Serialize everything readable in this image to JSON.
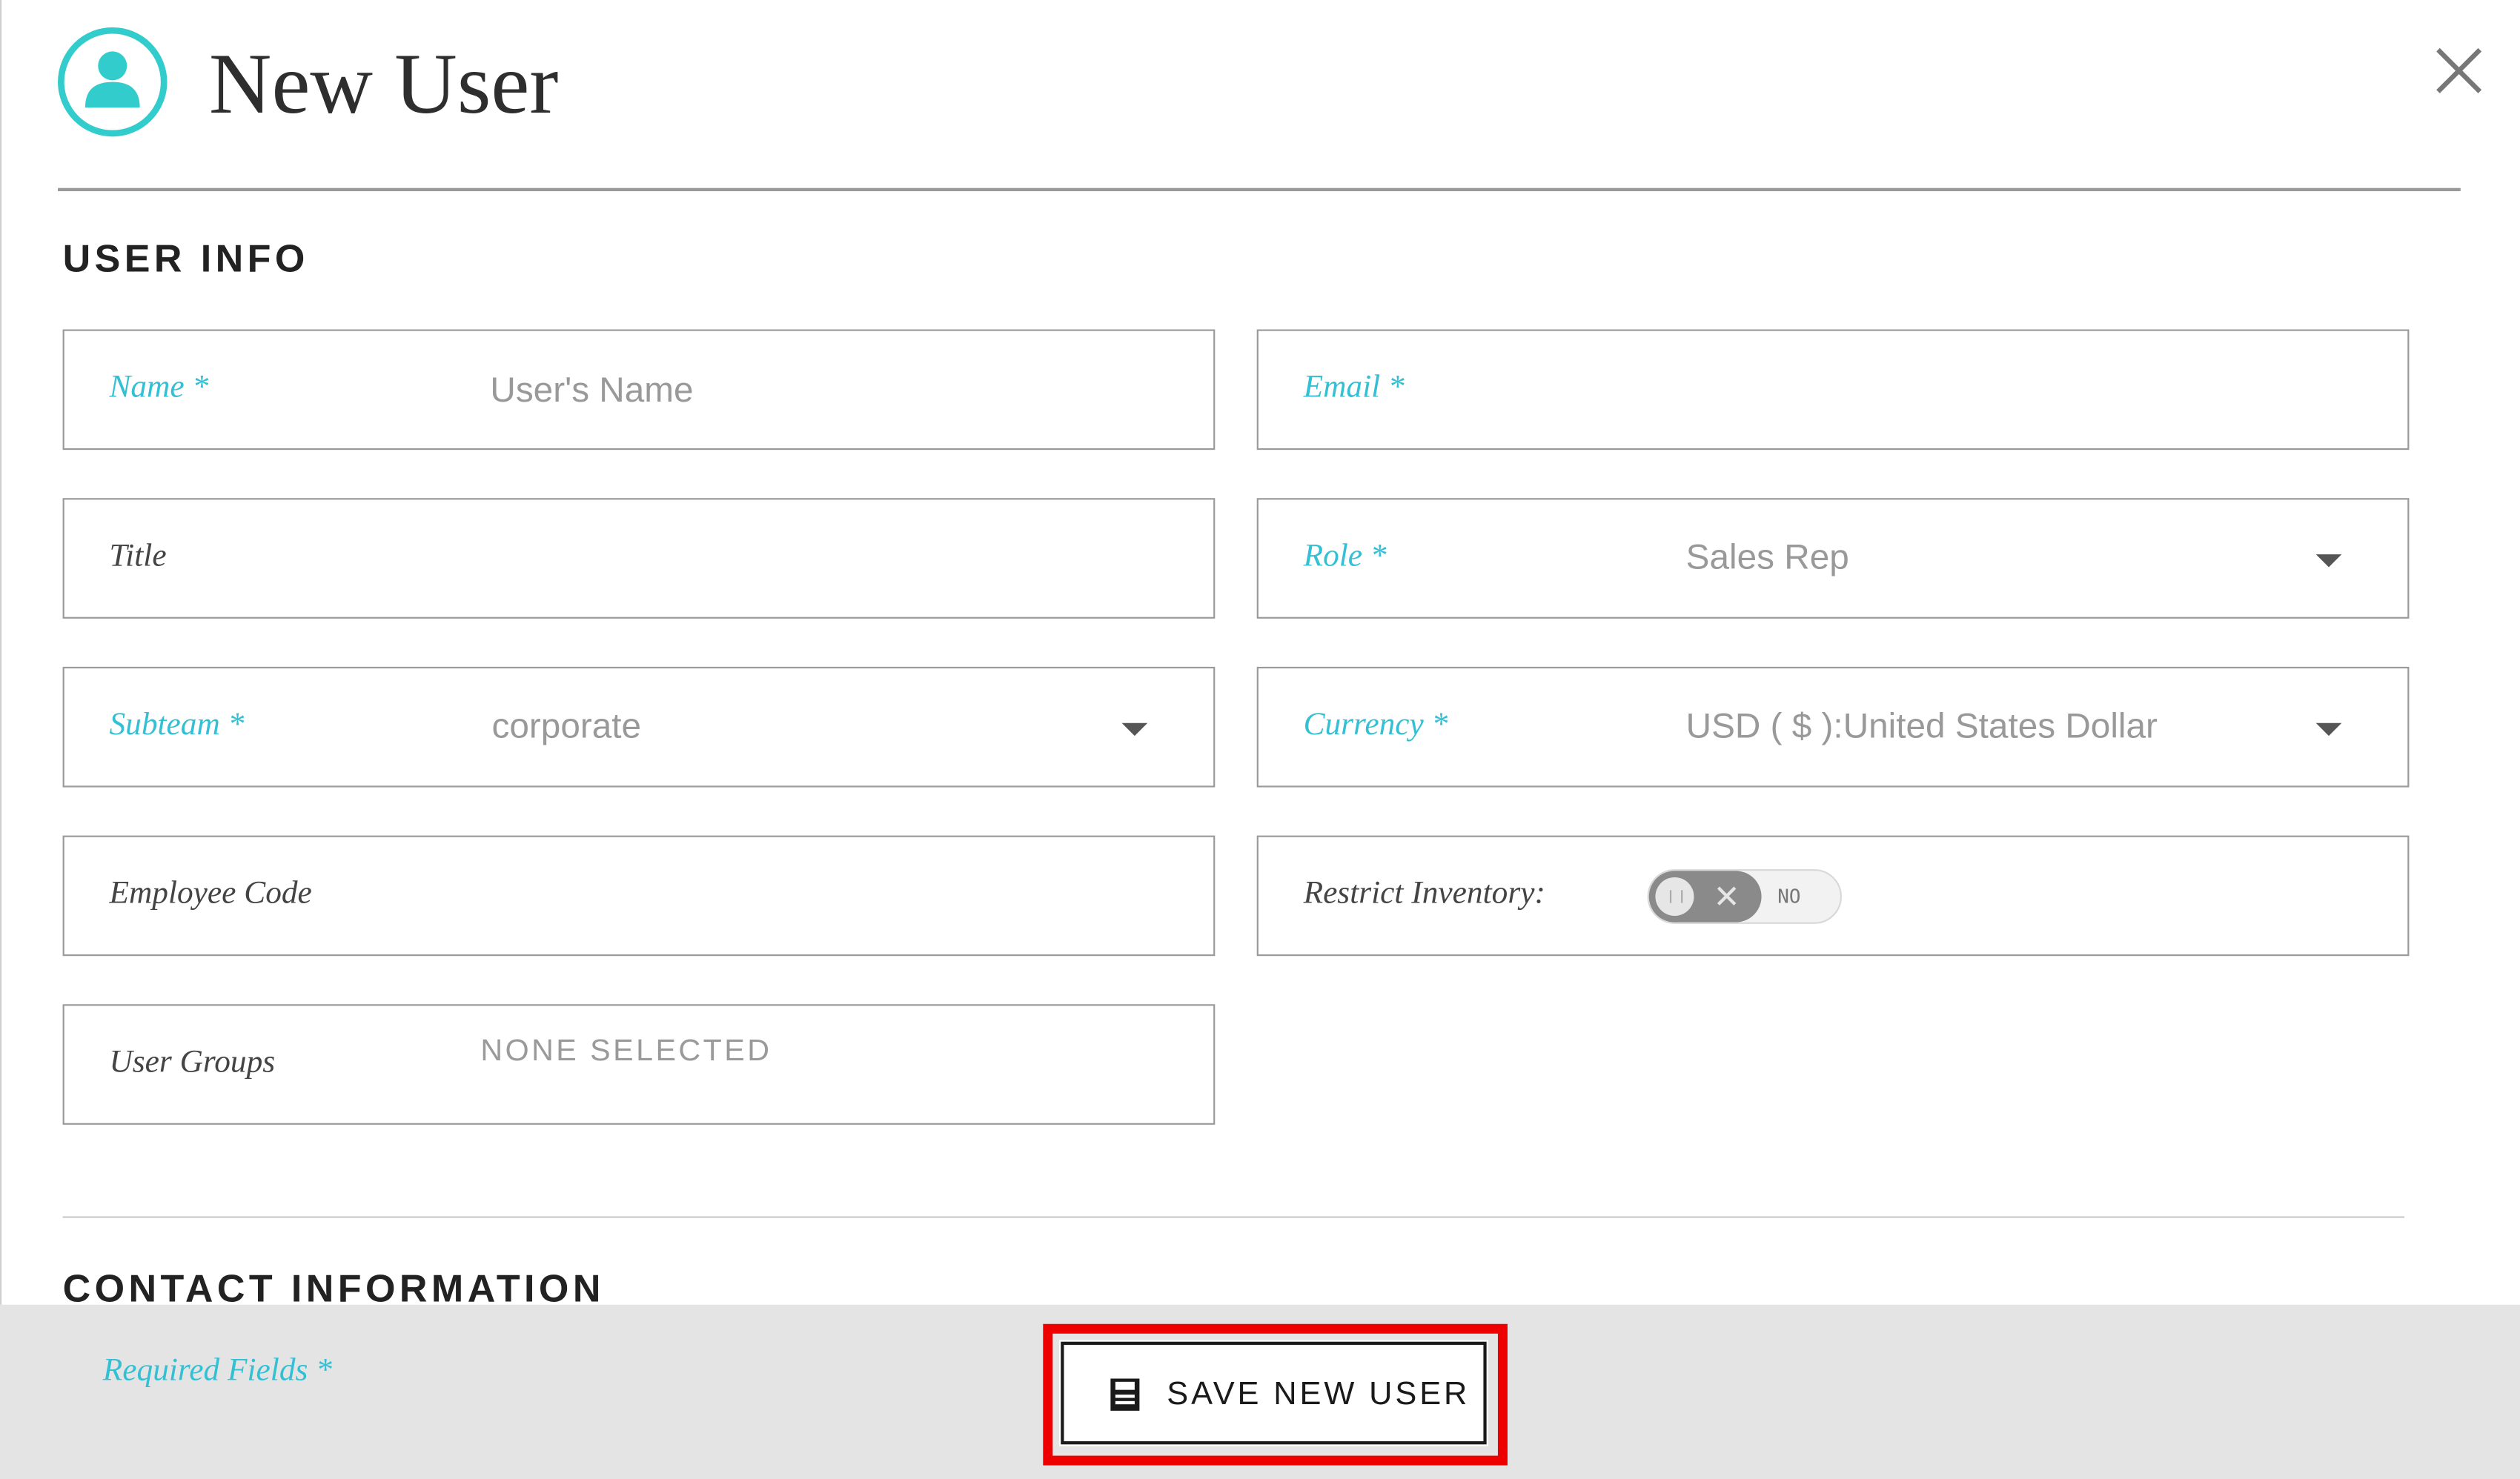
{
  "modal": {
    "title": "New User",
    "user_icon": "user-avatar-icon",
    "close_icon": "close-icon"
  },
  "user_info": {
    "heading": "USER INFO",
    "name": {
      "label": "Name *",
      "placeholder": "User's Name",
      "value": ""
    },
    "email": {
      "label": "Email *",
      "value": ""
    },
    "title": {
      "label": "Title",
      "value": ""
    },
    "role": {
      "label": "Role *",
      "value": "Sales Rep"
    },
    "subteam": {
      "label": "Subteam *",
      "value": "corporate"
    },
    "currency": {
      "label": "Currency *",
      "value": "USD ( $ ):United States Dollar"
    },
    "employee_code": {
      "label": "Employee Code",
      "value": ""
    },
    "restrict_inventory": {
      "label": "Restrict Inventory:",
      "toggle_state": "NO"
    },
    "user_groups": {
      "label": "User Groups",
      "value": "NONE SELECTED"
    }
  },
  "contact_info": {
    "heading": "CONTACT INFORMATION"
  },
  "footer": {
    "required_note": "Required Fields *",
    "save_label": "SAVE NEW USER",
    "save_icon": "save-disk-icon"
  },
  "colors": {
    "accent": "#33c0d4",
    "icon_teal": "#33cccc",
    "highlight": "#ee0000",
    "footer_bg": "#e4e4e4"
  }
}
